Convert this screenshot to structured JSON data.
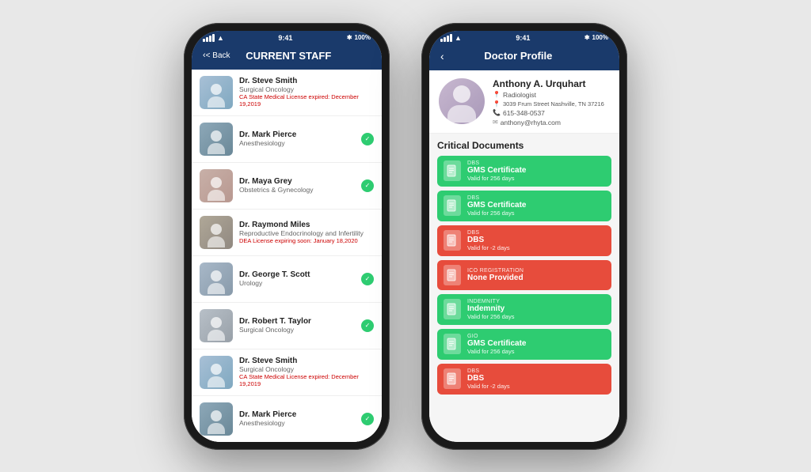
{
  "phone1": {
    "statusBar": {
      "signal": "●●●",
      "wifi": "wifi",
      "time": "9:41",
      "bluetooth": "bluetooth",
      "battery": "100%"
    },
    "header": {
      "backLabel": "< Back",
      "title": "CURRENT STAFF"
    },
    "staffList": [
      {
        "name": "Dr. Steve Smith",
        "specialty": "Surgical Oncology",
        "warning": "CA State Medical License expired: December 19,2019",
        "hasCheck": false,
        "avatarClass": "avatar-doctor1"
      },
      {
        "name": "Dr. Mark Pierce",
        "specialty": "Anesthesiology",
        "warning": "",
        "hasCheck": true,
        "avatarClass": "avatar-doctor2"
      },
      {
        "name": "Dr. Maya Grey",
        "specialty": "Obstetrics & Gynecology",
        "warning": "",
        "hasCheck": true,
        "avatarClass": "avatar-doctor3"
      },
      {
        "name": "Dr. Raymond Miles",
        "specialty": "Reproductive Endocrinology and Infertility",
        "warning": "DEA License expiring soon: January 18,2020",
        "hasCheck": false,
        "avatarClass": "avatar-doctor4"
      },
      {
        "name": "Dr. George T. Scott",
        "specialty": "Urology",
        "warning": "",
        "hasCheck": true,
        "avatarClass": "avatar-doctor5"
      },
      {
        "name": "Dr. Robert T. Taylor",
        "specialty": "Surgical Oncology",
        "warning": "",
        "hasCheck": true,
        "avatarClass": "avatar-doctor6"
      },
      {
        "name": "Dr. Steve Smith",
        "specialty": "Surgical Oncology",
        "warning": "CA State Medical License expired: December 19,2019",
        "hasCheck": false,
        "avatarClass": "avatar-doctor7"
      },
      {
        "name": "Dr. Mark Pierce",
        "specialty": "Anesthesiology",
        "warning": "",
        "hasCheck": true,
        "avatarClass": "avatar-doctor8"
      }
    ]
  },
  "phone2": {
    "statusBar": {
      "signal": "●●●",
      "wifi": "wifi",
      "time": "9:41",
      "bluetooth": "bluetooth",
      "battery": "100%"
    },
    "header": {
      "backLabel": "<",
      "title": "Doctor Profile"
    },
    "doctor": {
      "name": "Anthony A. Urquhart",
      "role": "Radiologist",
      "address": "3039 Frum Street Nashville, TN 37216",
      "phone": "615-348-0537",
      "email": "anthony@rhyta.com"
    },
    "criticalDocuments": {
      "title": "Critical Documents",
      "docs": [
        {
          "type": "DBS",
          "name": "GMS Certificate",
          "validity": "Valid for 256 days",
          "color": "green"
        },
        {
          "type": "DBS",
          "name": "GMS Certificate",
          "validity": "Valid for 256 days",
          "color": "green"
        },
        {
          "type": "DBS",
          "name": "DBS",
          "validity": "Valid for -2 days",
          "color": "red"
        },
        {
          "type": "ICO REGISTRATION",
          "name": "None Provided",
          "validity": "",
          "color": "red"
        },
        {
          "type": "INDEMNITY",
          "name": "Indemnity",
          "validity": "Valid for 256 days",
          "color": "green"
        },
        {
          "type": "GIO",
          "name": "GMS Certificate",
          "validity": "Valid for 256 days",
          "color": "green"
        },
        {
          "type": "DBS",
          "name": "DBS",
          "validity": "Valid for -2 days",
          "color": "red"
        }
      ]
    }
  }
}
